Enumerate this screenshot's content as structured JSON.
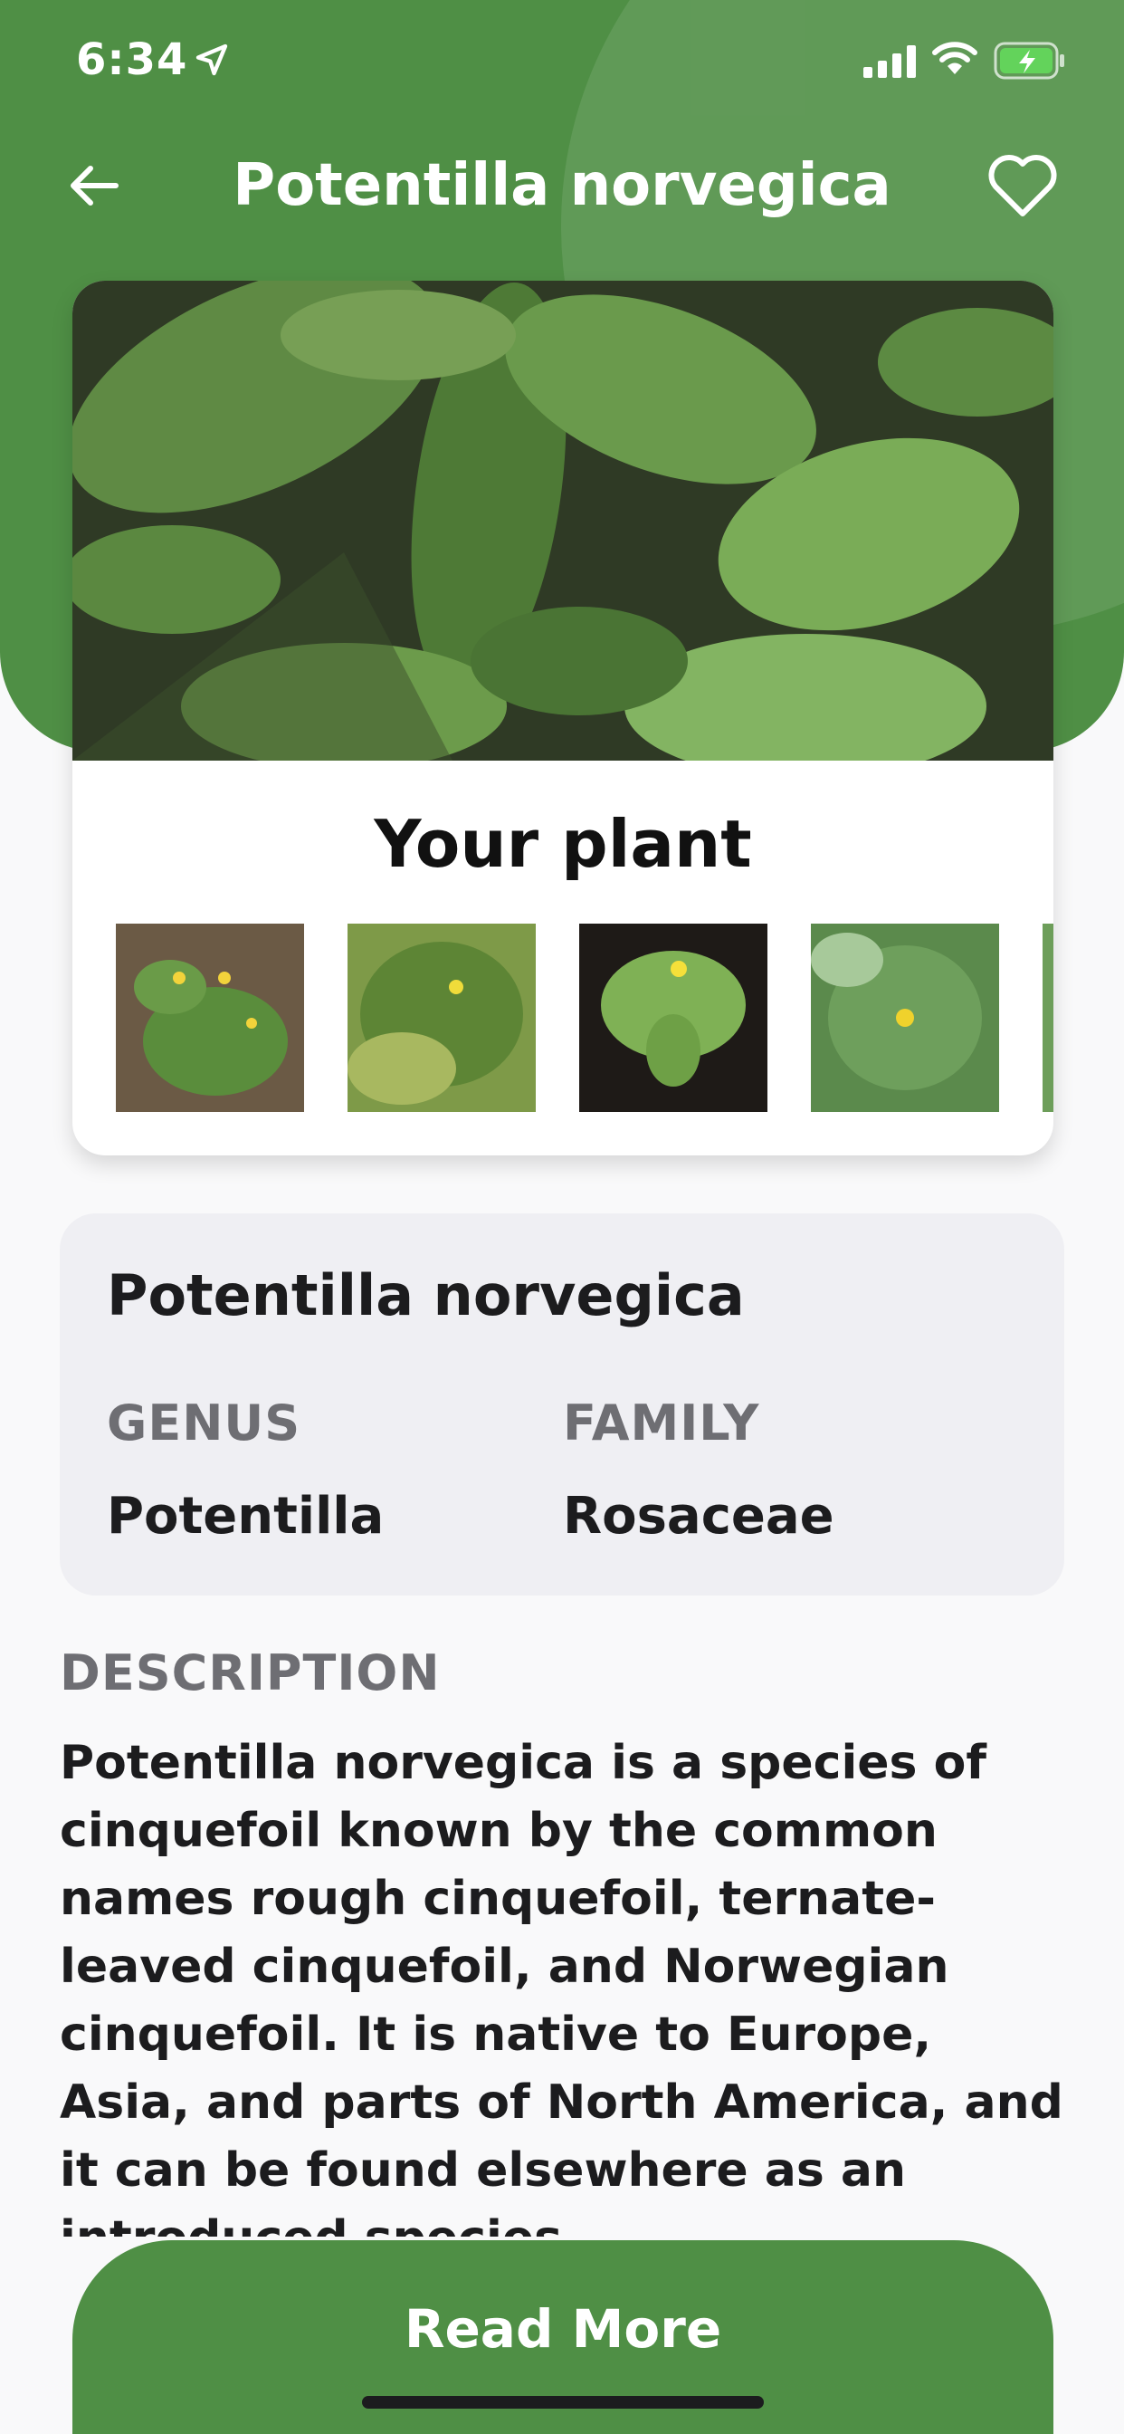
{
  "status_bar": {
    "time": "6:34",
    "location_icon": "location-arrow-icon",
    "signal_icon": "cellular-signal-icon",
    "wifi_icon": "wifi-icon",
    "battery_icon": "battery-charging-icon"
  },
  "header": {
    "title": "Potentilla norvegica",
    "back_icon": "arrow-left-icon",
    "favorite_icon": "heart-outline-icon"
  },
  "colors": {
    "brand_green": "#4f8f45",
    "panel_gray": "#efeff3",
    "label_gray": "#6e6e73",
    "text_dark": "#1c1c1e"
  },
  "plant_card": {
    "section_title": "Your plant",
    "thumbnails_count_visible": 4
  },
  "info": {
    "name": "Potentilla norvegica",
    "genus_label": "GENUS",
    "genus": "Potentilla",
    "family_label": "FAMILY",
    "family": "Rosaceae"
  },
  "description": {
    "label": "DESCRIPTION",
    "text": "Potentilla norvegica is a species of cinquefoil known by the common names rough cinquefoil, ternate-leaved cinquefoil, and Norwegian cinquefoil. It is native to Europe, Asia, and parts of North America, and it can be found elsewhere as an introduced species."
  },
  "actions": {
    "read_more": "Read More"
  }
}
